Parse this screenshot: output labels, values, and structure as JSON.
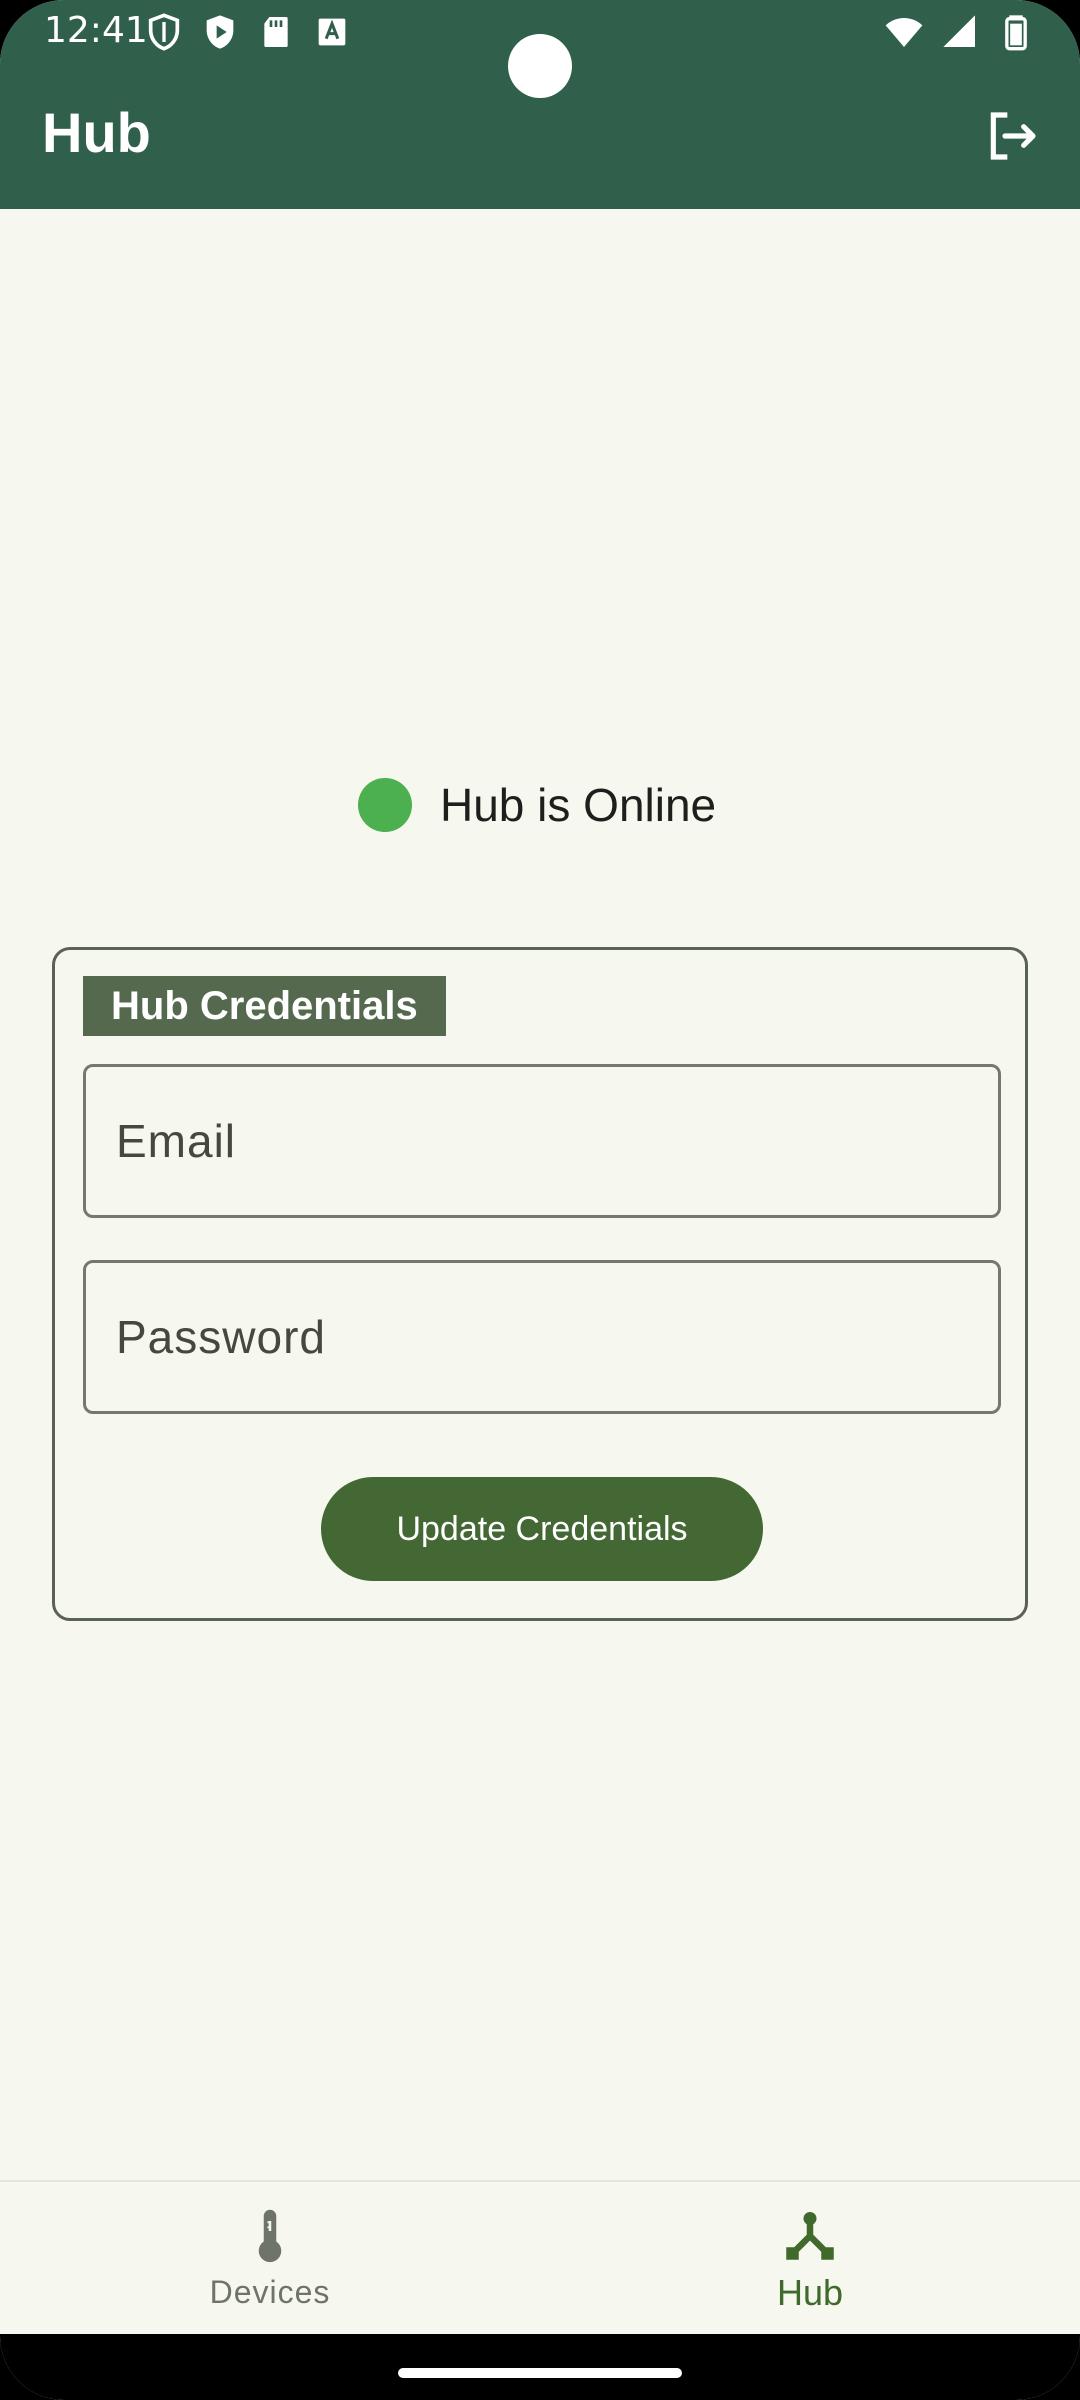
{
  "status_bar": {
    "time": "12:41",
    "left_icons": [
      "shield-icon",
      "play-protect-icon",
      "sd-card-icon",
      "keyboard-a-icon"
    ],
    "right_icons": [
      "wifi-icon",
      "cellular-signal-icon",
      "battery-icon"
    ]
  },
  "app_bar": {
    "title": "Hub",
    "logout_icon": "logout-icon"
  },
  "hub_status": {
    "text": "Hub is Online",
    "color": "#4caf50"
  },
  "credentials": {
    "header": "Hub Credentials",
    "email": {
      "placeholder": "Email",
      "value": ""
    },
    "password": {
      "placeholder": "Password",
      "value": ""
    },
    "update_button": "Update Credentials"
  },
  "bottom_nav": {
    "items": [
      {
        "label": "Devices",
        "icon": "thermometer-icon",
        "selected": false
      },
      {
        "label": "Hub",
        "icon": "hub-icon",
        "selected": true
      }
    ]
  },
  "colors": {
    "app_bar": "#30604b",
    "background": "#f6f7ee",
    "primary_button": "#436833",
    "selected_nav": "#3f6a2c"
  }
}
